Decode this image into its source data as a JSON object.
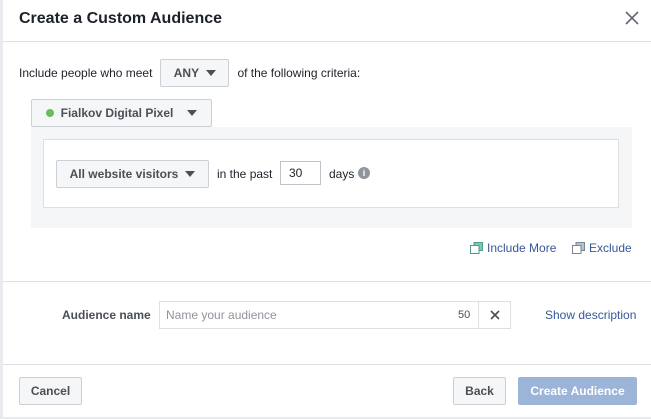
{
  "dialog": {
    "title": "Create a Custom Audience"
  },
  "criteria": {
    "intro_label": "Include people who meet",
    "match_mode": "ANY",
    "suffix_label": "of the following criteria:",
    "pixel": {
      "name": "Fialkov Digital Pixel",
      "status_color": "#6bbd5b"
    },
    "rule": {
      "traffic": "All website visitors",
      "in_the_past_label": "in the past",
      "days_value": "30",
      "days_label": "days",
      "info_glyph": "i"
    },
    "include_more_label": "Include More",
    "exclude_label": "Exclude"
  },
  "audience_name": {
    "label": "Audience name",
    "placeholder": "Name your audience",
    "value": "",
    "char_count": "50",
    "show_description_label": "Show description"
  },
  "footer": {
    "cancel_label": "Cancel",
    "back_label": "Back",
    "create_label": "Create Audience"
  },
  "colors": {
    "link": "#365899",
    "primary_disabled": "#9cb4d8",
    "status_green": "#6bbd5b"
  }
}
